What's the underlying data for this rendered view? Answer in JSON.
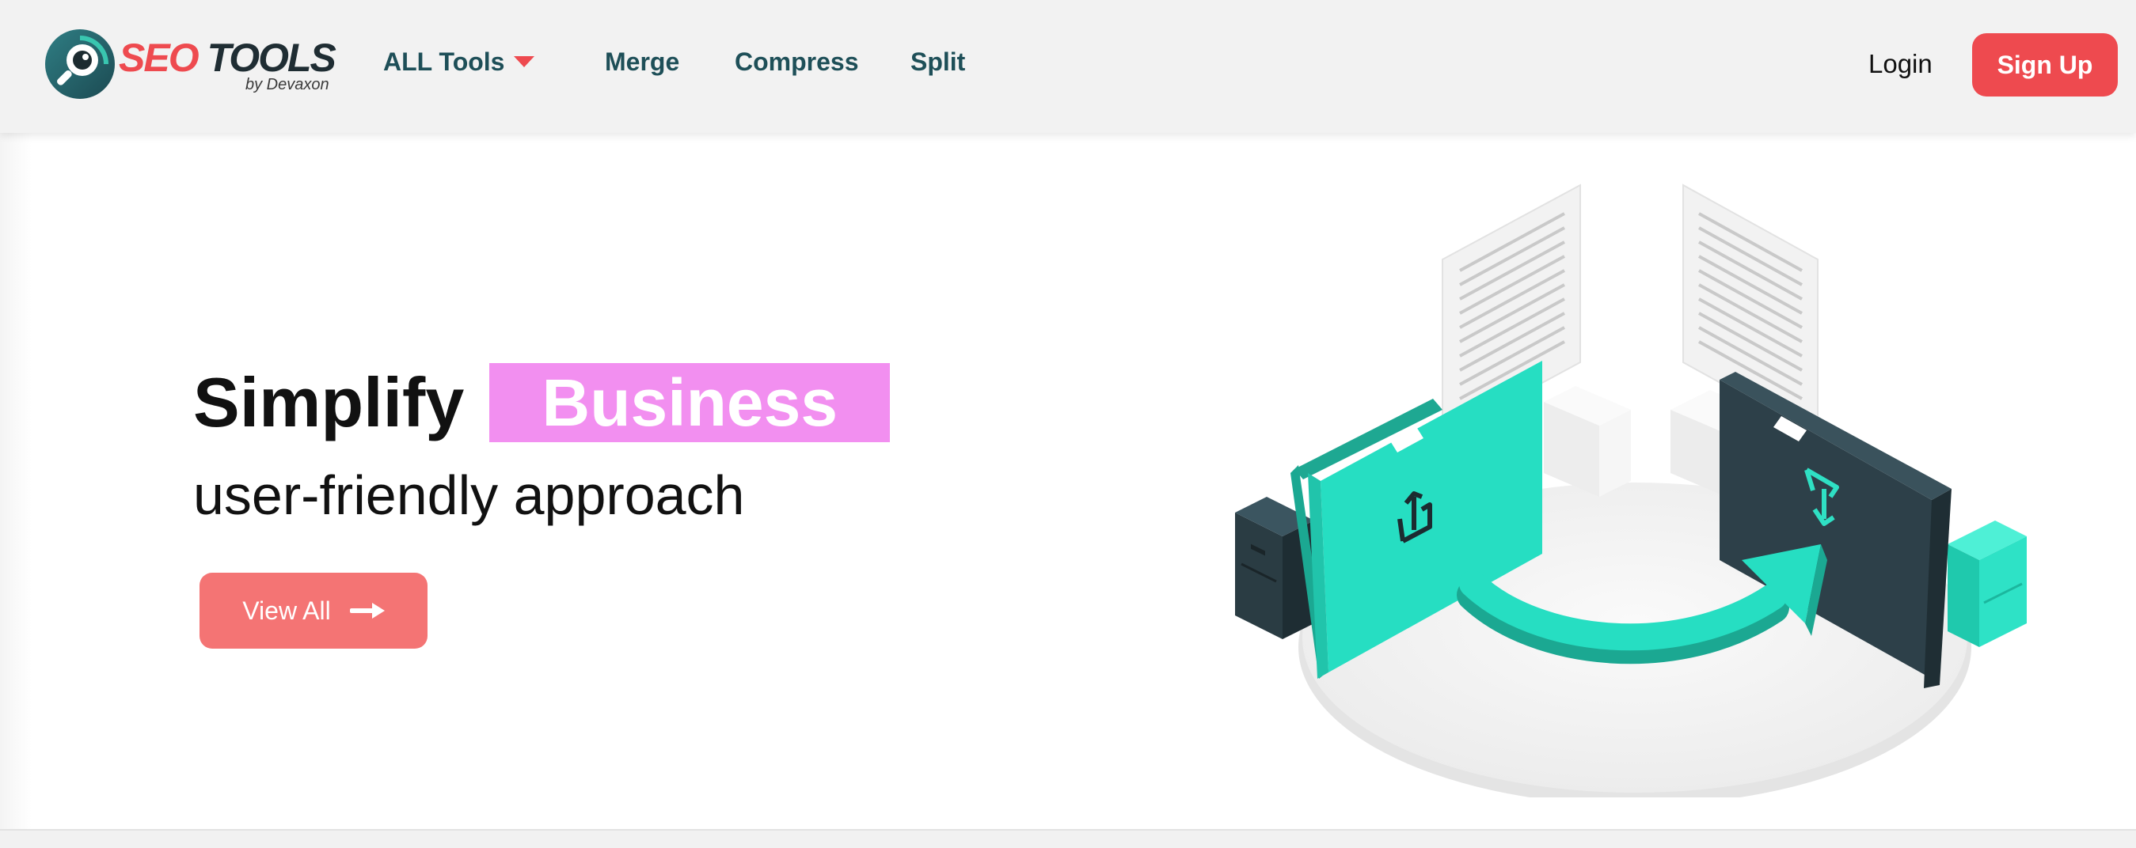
{
  "brand": {
    "name_part1": "SEO",
    "name_part2": "TOOLS",
    "byline": "by Devaxon"
  },
  "nav": {
    "all_tools": "ALL Tools",
    "merge": "Merge",
    "compress": "Compress",
    "split": "Split"
  },
  "auth": {
    "login": "Login",
    "signup": "Sign Up"
  },
  "hero": {
    "headline_word": "Simplify",
    "headline_highlight": "Business",
    "subline": "user-friendly approach",
    "cta_label": "View All"
  },
  "icons": {
    "logo": "magnifier-eye-logo-icon",
    "nav_caret": "caret-down-icon",
    "cta_arrow": "arrow-right-icon",
    "upload": "upload-icon",
    "download": "download-icon"
  },
  "colors": {
    "brand_red": "#ee4a4f",
    "nav_teal": "#1e4f58",
    "highlight_pink": "#f28ff0",
    "cta_salmon": "#f47474",
    "folder_teal": "#26dec2",
    "folder_dark": "#2d4049"
  }
}
